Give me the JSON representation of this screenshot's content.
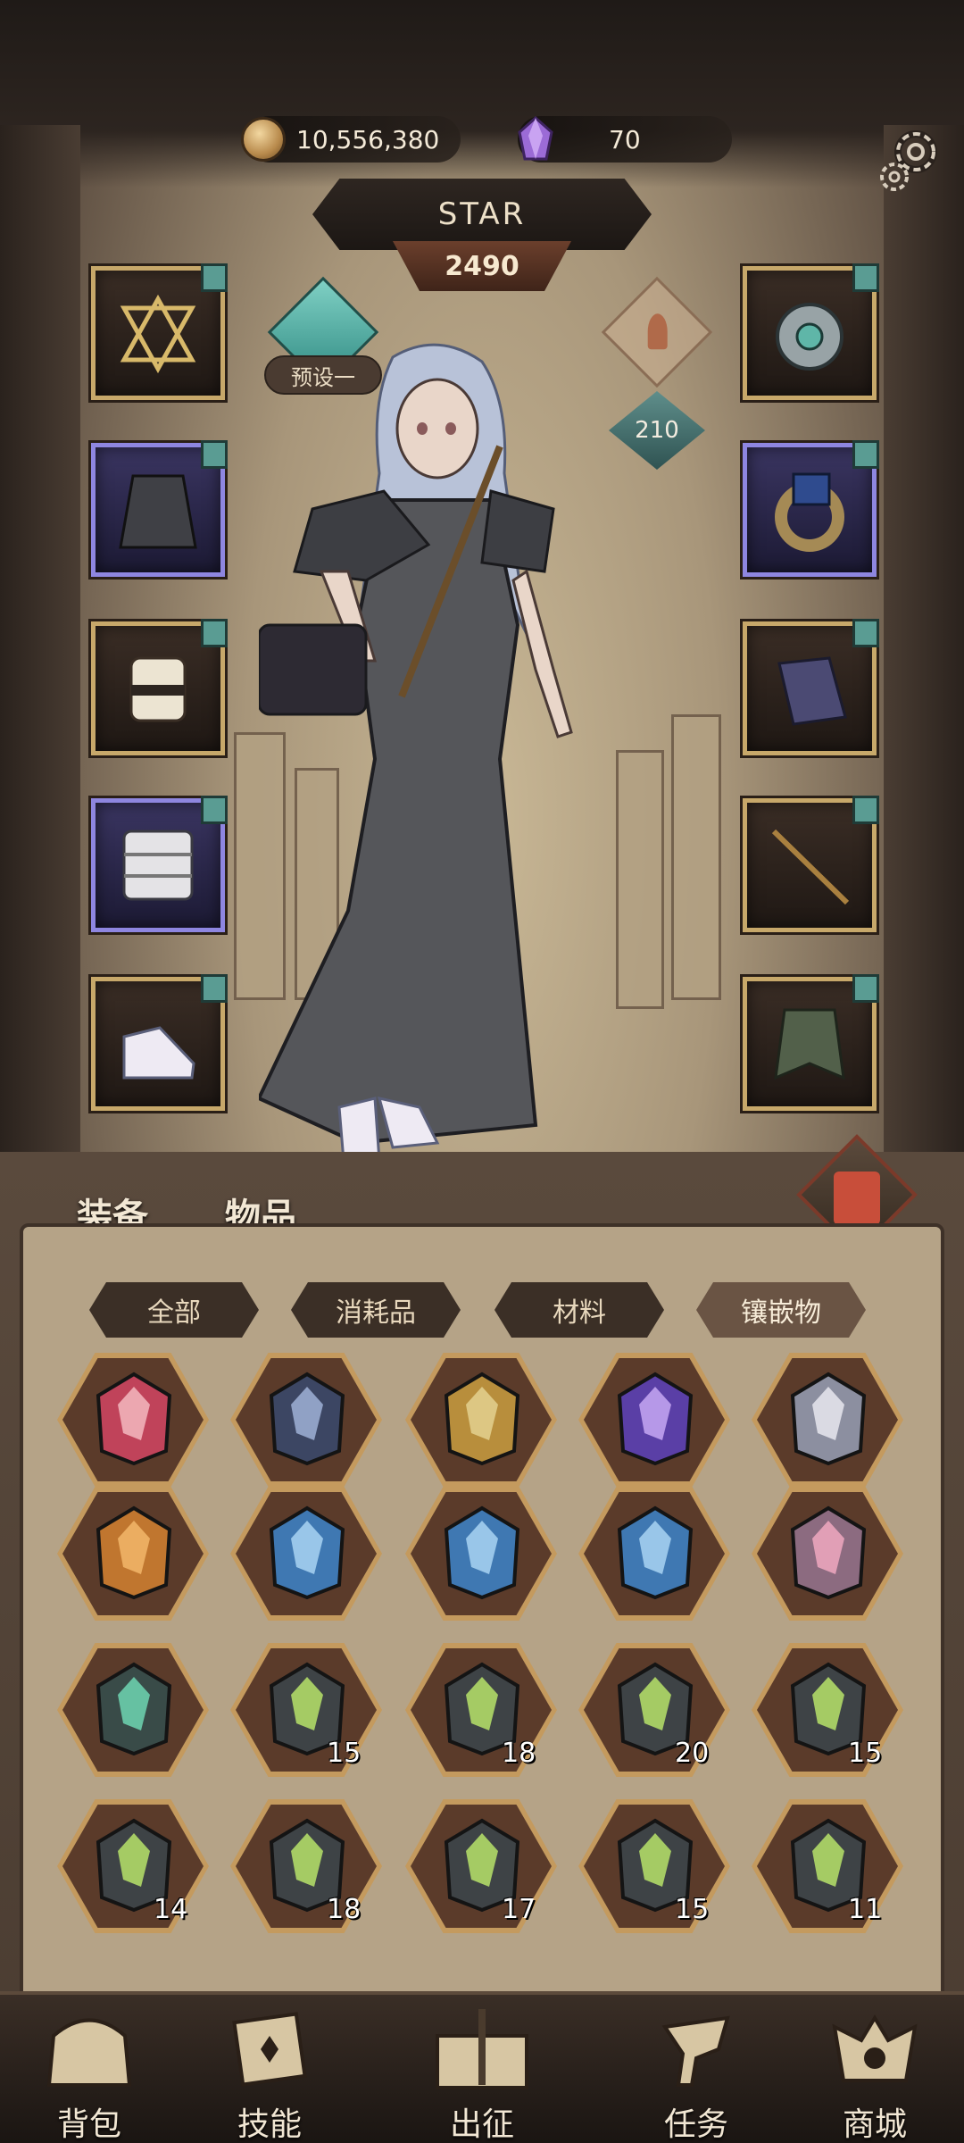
{
  "currency": {
    "gold": "10,556,380",
    "crystals": "70"
  },
  "player": {
    "name": "STAR",
    "score": "2490",
    "preset": "预设一",
    "power": "210"
  },
  "equipment": {
    "left": [
      {
        "name": "amulet",
        "frame": "gold"
      },
      {
        "name": "robe",
        "frame": "purple"
      },
      {
        "name": "bracer",
        "frame": "gold"
      },
      {
        "name": "greaves",
        "frame": "purple"
      },
      {
        "name": "shoes",
        "frame": "gold"
      }
    ],
    "right": [
      {
        "name": "medallion",
        "frame": "gold"
      },
      {
        "name": "ring",
        "frame": "purple"
      },
      {
        "name": "gauntlet",
        "frame": "gold"
      },
      {
        "name": "staff",
        "frame": "gold"
      },
      {
        "name": "cloak",
        "frame": "gold"
      }
    ]
  },
  "bag_tabs": {
    "equipment": "装备",
    "items": "物品"
  },
  "filters": [
    "全部",
    "消耗品",
    "材料",
    "镶嵌物"
  ],
  "active_filter": "镶嵌物",
  "inventory": [
    {
      "kind": "crystal-red",
      "count": ""
    },
    {
      "kind": "rune-dark",
      "count": ""
    },
    {
      "kind": "prism-gold",
      "count": ""
    },
    {
      "kind": "orb-purple",
      "count": ""
    },
    {
      "kind": "cluster-mixed",
      "count": ""
    },
    {
      "kind": "claw-orange",
      "count": ""
    },
    {
      "kind": "ice-shard",
      "count": ""
    },
    {
      "kind": "ice-shard",
      "count": ""
    },
    {
      "kind": "ice-shard",
      "count": ""
    },
    {
      "kind": "gem-pile",
      "count": ""
    },
    {
      "kind": "green-crystal",
      "count": ""
    },
    {
      "kind": "rune-stone",
      "count": "15"
    },
    {
      "kind": "rune-stone",
      "count": "18"
    },
    {
      "kind": "rune-stone",
      "count": "20"
    },
    {
      "kind": "rune-stone",
      "count": "15"
    },
    {
      "kind": "rune-stone",
      "count": "14"
    },
    {
      "kind": "rune-stone",
      "count": "18"
    },
    {
      "kind": "rune-stone",
      "count": "17"
    },
    {
      "kind": "rune-stone",
      "count": "15"
    },
    {
      "kind": "rune-stone",
      "count": "11"
    }
  ],
  "nav": [
    "背包",
    "技能",
    "出征",
    "任务",
    "商城"
  ],
  "colors": {
    "gold_frame": "#c7a86a",
    "purple_frame": "#8e86e0",
    "accent_teal": "#5a9c93"
  }
}
